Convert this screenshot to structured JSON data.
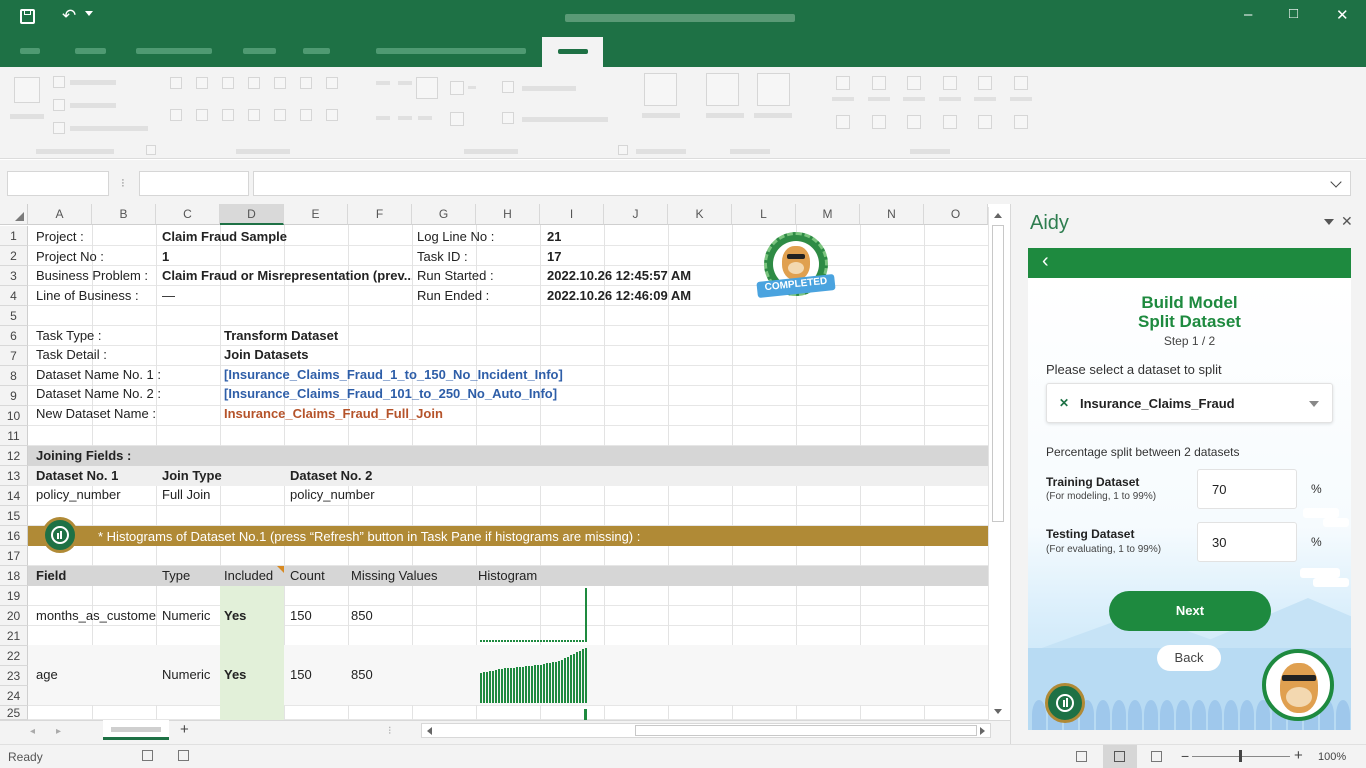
{
  "app": {
    "colors": {
      "brand": "#1e7145",
      "accent": "#1e8a3f",
      "link": "#2e5ea8",
      "orange": "#b5532a",
      "banner": "#b08a36"
    }
  },
  "titlebar": {
    "save_icon": "save-icon",
    "undo_icon": "undo-icon",
    "minimize": "–",
    "maximize": "□",
    "close": "✕"
  },
  "sheet": {
    "columns": [
      "A",
      "B",
      "C",
      "D",
      "E",
      "F",
      "G",
      "H",
      "I",
      "J",
      "K",
      "L",
      "M",
      "N",
      "O"
    ],
    "rows": [
      "1",
      "2",
      "3",
      "4",
      "5",
      "6",
      "7",
      "8",
      "9",
      "10",
      "11",
      "12",
      "13",
      "14",
      "15",
      "16",
      "17",
      "18",
      "19",
      "20",
      "21",
      "22",
      "23",
      "24",
      "25"
    ],
    "project_label": "Project :",
    "project_value": "Claim Fraud Sample",
    "projectno_label": "Project No :",
    "projectno_value": "1",
    "business_label": "Business Problem :",
    "business_value": "Claim Fraud or Misrepresentation (prev...)",
    "lob_label": "Line of Business :",
    "lob_value": "—",
    "logline_label": "Log Line No :",
    "logline_value": "21",
    "taskid_label": "Task ID :",
    "taskid_value": "17",
    "runstart_label": "Run Started :",
    "runstart_value": "2022.10.26 12:45:57 AM",
    "runend_label": "Run Ended :",
    "runend_value": "2022.10.26 12:46:09 AM",
    "completed_badge": "COMPLETED",
    "tasktype_label": "Task Type :",
    "tasktype_value": "Transform Dataset",
    "taskdetail_label": "Task Detail :",
    "taskdetail_value": "Join Datasets",
    "ds1_label": "Dataset Name No. 1 :",
    "ds1_value": "[Insurance_Claims_Fraud_1_to_150_No_Incident_Info]",
    "ds2_label": "Dataset Name No. 2 :",
    "ds2_value": "[Insurance_Claims_Fraud_101_to_250_No_Auto_Info]",
    "newds_label": "New Dataset Name :",
    "newds_value": "Insurance_Claims_Fraud_Full_Join",
    "joining_title": "Joining Fields :",
    "join_headers": [
      "Dataset No. 1",
      "Join Type",
      "Dataset No. 2"
    ],
    "join_row": [
      "policy_number",
      "Full Join",
      "policy_number"
    ],
    "banner_text": "* Histograms of Dataset No.1 (press “Refresh” button in Task Pane if histograms are missing) :",
    "hist_headers": [
      "Field",
      "Type",
      "Included",
      "Count",
      "Missing Values",
      "Histogram"
    ],
    "hist_rows": [
      {
        "field": "months_as_custome",
        "type": "Numeric",
        "included": "Yes",
        "count": "150",
        "missing": "850",
        "bars": [
          0.04,
          0.04,
          0.04,
          0.04,
          0.04,
          0.04,
          0.04,
          0.04,
          0.04,
          0.04,
          0.04,
          0.04,
          0.04,
          0.04,
          0.04,
          0.04,
          0.04,
          0.04,
          0.04,
          0.04,
          0.04,
          0.04,
          0.04,
          0.04,
          0.04,
          0.04,
          0.04,
          0.04,
          0.04,
          0.04,
          0.04,
          0.04,
          0.04,
          0.04,
          0.04,
          1.0
        ]
      },
      {
        "field": "age",
        "type": "Numeric",
        "included": "Yes",
        "count": "150",
        "missing": "850",
        "bars": [
          0.55,
          0.56,
          0.57,
          0.58,
          0.59,
          0.6,
          0.61,
          0.62,
          0.63,
          0.63,
          0.64,
          0.64,
          0.65,
          0.66,
          0.66,
          0.67,
          0.67,
          0.68,
          0.69,
          0.7,
          0.7,
          0.71,
          0.72,
          0.73,
          0.74,
          0.75,
          0.77,
          0.79,
          0.81,
          0.84,
          0.87,
          0.9,
          0.92,
          0.95,
          0.98,
          1.0
        ]
      }
    ]
  },
  "sheettabs": {
    "add": "+"
  },
  "status": {
    "ready": "Ready",
    "zoom": "100%",
    "minus": "−",
    "plus": "+"
  },
  "pane": {
    "title": "Aidy",
    "back_arrow": "‹",
    "heading1": "Build Model",
    "heading2": "Split Dataset",
    "step": "Step 1 / 2",
    "select_label": "Please select a dataset to split",
    "dataset_value": "Insurance_Claims_Fraud",
    "dataset_icon": "✕",
    "split_label": "Percentage split between 2 datasets",
    "training_label": "Training Dataset",
    "training_sub": "(For modeling, 1 to 99%)",
    "training_value": "70",
    "testing_label": "Testing Dataset",
    "testing_sub": "(For evaluating, 1 to 99%)",
    "testing_value": "30",
    "pct": "%",
    "next": "Next",
    "back": "Back"
  }
}
